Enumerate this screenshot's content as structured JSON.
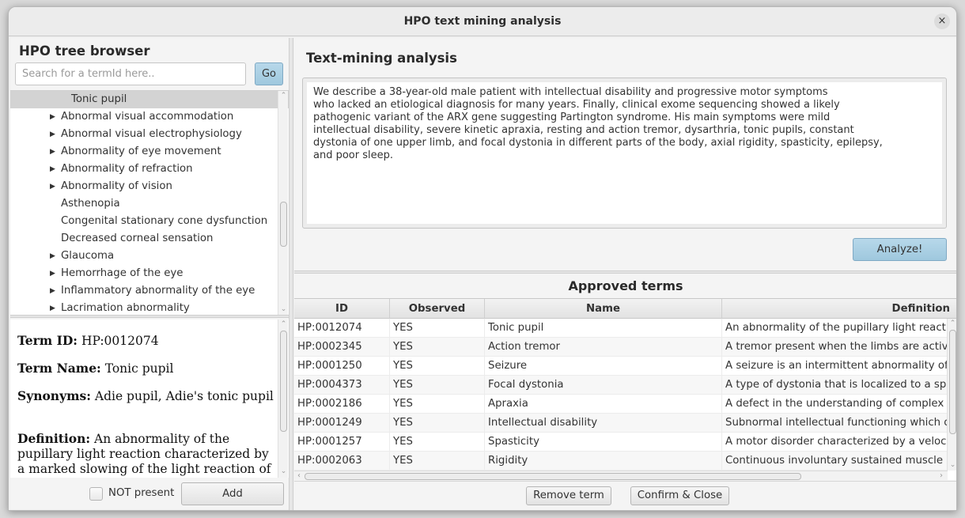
{
  "window": {
    "title": "HPO text mining analysis",
    "close_icon": "×"
  },
  "left_panel": {
    "title": "HPO tree browser",
    "search": {
      "placeholder": "Search for a termId here..",
      "value": ""
    },
    "go_label": "Go",
    "tree": {
      "selected": "Tonic pupil",
      "items": [
        {
          "label": "Abnormal visual accommodation",
          "expandable": true
        },
        {
          "label": "Abnormal visual electrophysiology",
          "expandable": true
        },
        {
          "label": "Abnormality of eye movement",
          "expandable": true
        },
        {
          "label": "Abnormality of refraction",
          "expandable": true
        },
        {
          "label": "Abnormality of vision",
          "expandable": true
        },
        {
          "label": "Asthenopia",
          "expandable": false
        },
        {
          "label": "Congenital stationary cone dysfunction",
          "expandable": false
        },
        {
          "label": "Decreased corneal sensation",
          "expandable": false
        },
        {
          "label": "Glaucoma",
          "expandable": true
        },
        {
          "label": "Hemorrhage of the eye",
          "expandable": true
        },
        {
          "label": "Inflammatory abnormality of the eye",
          "expandable": true
        },
        {
          "label": "Lacrimation abnormality",
          "expandable": true
        }
      ],
      "expand_icon": "▶"
    },
    "details": {
      "term_id_label": "Term ID:",
      "term_id": "HP:0012074",
      "term_name_label": "Term Name:",
      "term_name": "Tonic pupil",
      "synonyms_label": "Synonyms:",
      "synonyms": "Adie pupil, Adie's tonic pupil",
      "definition_label": "Definition:",
      "definition": "An abnormality of the pupillary light reaction characterized by a marked slowing of the light reaction of"
    },
    "not_present_label": "NOT present",
    "not_present_checked": false,
    "add_label": "Add"
  },
  "right_panel": {
    "title": "Text-mining analysis",
    "input_text": "We describe a 38-year-old male patient with intellectual disability and progressive motor symptoms\nwho lacked an etiological diagnosis for many years. Finally, clinical exome sequencing showed a likely\npathogenic variant of the ARX gene suggesting Partington syndrome. His main symptoms were mild\nintellectual disability, severe kinetic apraxia, resting and action tremor, dysarthria, tonic pupils, constant\ndystonia of one upper limb, and focal dystonia in different parts of the body, axial rigidity, spasticity, epilepsy,\nand poor sleep.",
    "analyze_label": "Analyze!",
    "approved_title": "Approved terms",
    "table": {
      "columns": [
        "ID",
        "Observed",
        "Name",
        "Definition"
      ],
      "rows": [
        [
          "HP:0012074",
          "YES",
          "Tonic pupil",
          "An abnormality of the pupillary light reacti"
        ],
        [
          "HP:0002345",
          "YES",
          "Action tremor",
          "A tremor present when the limbs are activ"
        ],
        [
          "HP:0001250",
          "YES",
          "Seizure",
          "A seizure is an intermittent abnormality of"
        ],
        [
          "HP:0004373",
          "YES",
          "Focal dystonia",
          "A type of dystonia that is localized to a spe"
        ],
        [
          "HP:0002186",
          "YES",
          "Apraxia",
          "A defect in the understanding of complex r"
        ],
        [
          "HP:0001249",
          "YES",
          "Intellectual disability",
          "Subnormal intellectual functioning which o"
        ],
        [
          "HP:0001257",
          "YES",
          "Spasticity",
          "A motor disorder characterized by a veloci"
        ],
        [
          "HP:0002063",
          "YES",
          "Rigidity",
          "Continuous involuntary sustained muscle c"
        ]
      ]
    },
    "remove_label": "Remove term",
    "confirm_label": "Confirm & Close"
  },
  "scroll_icons": {
    "up": "⌃",
    "down": "⌄",
    "left": "‹",
    "right": "›"
  }
}
